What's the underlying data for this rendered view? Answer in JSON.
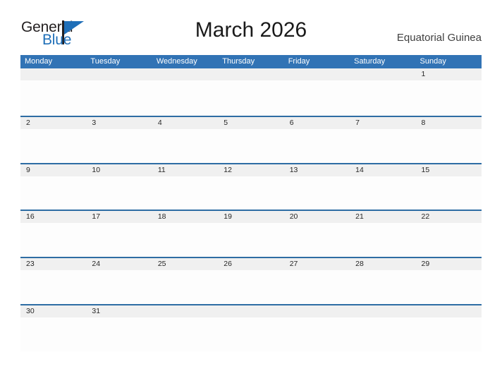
{
  "logo": {
    "word_one": "General",
    "word_two": "Blue",
    "triangle_icon": "triangle-icon",
    "brand_color": "#1f6fb8"
  },
  "header": {
    "title": "March 2026",
    "country": "Equatorial Guinea"
  },
  "calendar": {
    "month": "March",
    "year": "2026",
    "first_day_of_week": "Monday",
    "header_color": "#3173b5",
    "divider_color": "#2e6da4",
    "date_band_color": "#f0f0f0",
    "day_names": [
      "Monday",
      "Tuesday",
      "Wednesday",
      "Thursday",
      "Friday",
      "Saturday",
      "Sunday"
    ],
    "weeks": [
      [
        "",
        "",
        "",
        "",
        "",
        "",
        "1"
      ],
      [
        "2",
        "3",
        "4",
        "5",
        "6",
        "7",
        "8"
      ],
      [
        "9",
        "10",
        "11",
        "12",
        "13",
        "14",
        "15"
      ],
      [
        "16",
        "17",
        "18",
        "19",
        "20",
        "21",
        "22"
      ],
      [
        "23",
        "24",
        "25",
        "26",
        "27",
        "28",
        "29"
      ],
      [
        "30",
        "31",
        "",
        "",
        "",
        "",
        ""
      ]
    ]
  }
}
